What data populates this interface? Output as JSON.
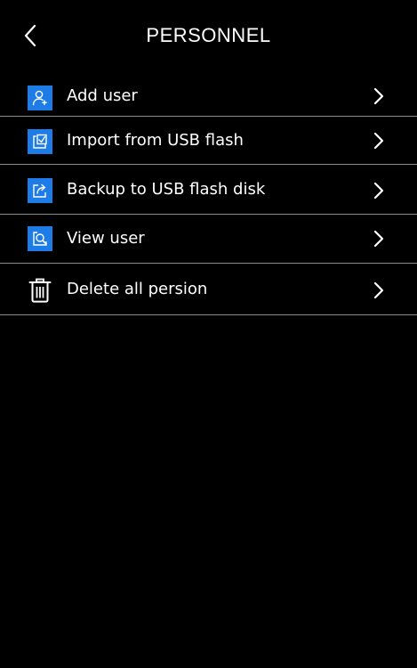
{
  "header": {
    "title": "PERSONNEL",
    "back_icon": "chevron-left-icon"
  },
  "menu": {
    "items": [
      {
        "label": "Add user",
        "icon": "add-user-icon"
      },
      {
        "label": "Import from USB flash",
        "icon": "import-icon"
      },
      {
        "label": "Backup to USB flash disk",
        "icon": "backup-icon"
      },
      {
        "label": "View user",
        "icon": "view-user-icon"
      },
      {
        "label": "Delete all persion",
        "icon": "trash-icon"
      }
    ]
  },
  "colors": {
    "background": "#000000",
    "icon_accent": "#1e7ce6",
    "divider": "#8a8a8a",
    "text": "#ffffff"
  }
}
